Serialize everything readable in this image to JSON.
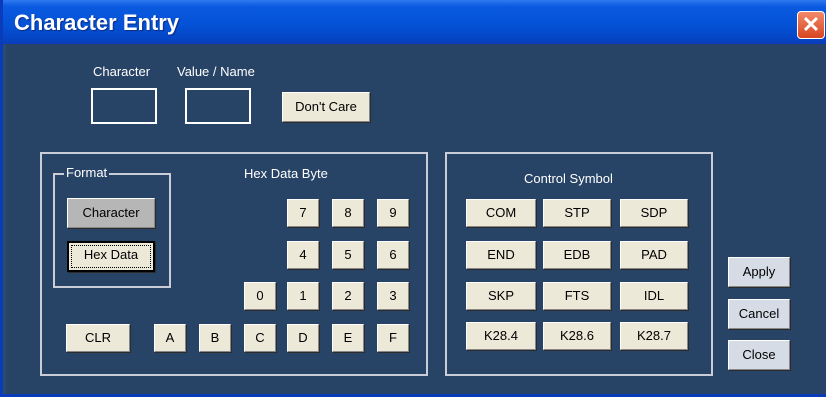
{
  "window": {
    "title": "Character Entry",
    "close_glyph": "✕"
  },
  "entry": {
    "character_label": "Character",
    "value_name_label": "Value / Name",
    "character_value": "",
    "value_name_value": "",
    "dont_care_label": "Don't Care"
  },
  "hex_panel": {
    "format_label": "Format",
    "format_character_label": "Character",
    "format_hex_data_label": "Hex Data",
    "hex_data_byte_label": "Hex Data Byte",
    "keys": {
      "k7": "7",
      "k8": "8",
      "k9": "9",
      "k4": "4",
      "k5": "5",
      "k6": "6",
      "k0": "0",
      "k1": "1",
      "k2": "2",
      "k3": "3",
      "ka": "A",
      "kb": "B",
      "kc": "C",
      "kd": "D",
      "ke": "E",
      "kf": "F"
    },
    "clr_label": "CLR"
  },
  "control_panel": {
    "title": "Control Symbol",
    "symbols": [
      "COM",
      "STP",
      "SDP",
      "END",
      "EDB",
      "PAD",
      "SKP",
      "FTS",
      "IDL",
      "K28.4",
      "K28.6",
      "K28.7"
    ]
  },
  "actions": {
    "apply_label": "Apply",
    "cancel_label": "Cancel",
    "close_label": "Close"
  }
}
